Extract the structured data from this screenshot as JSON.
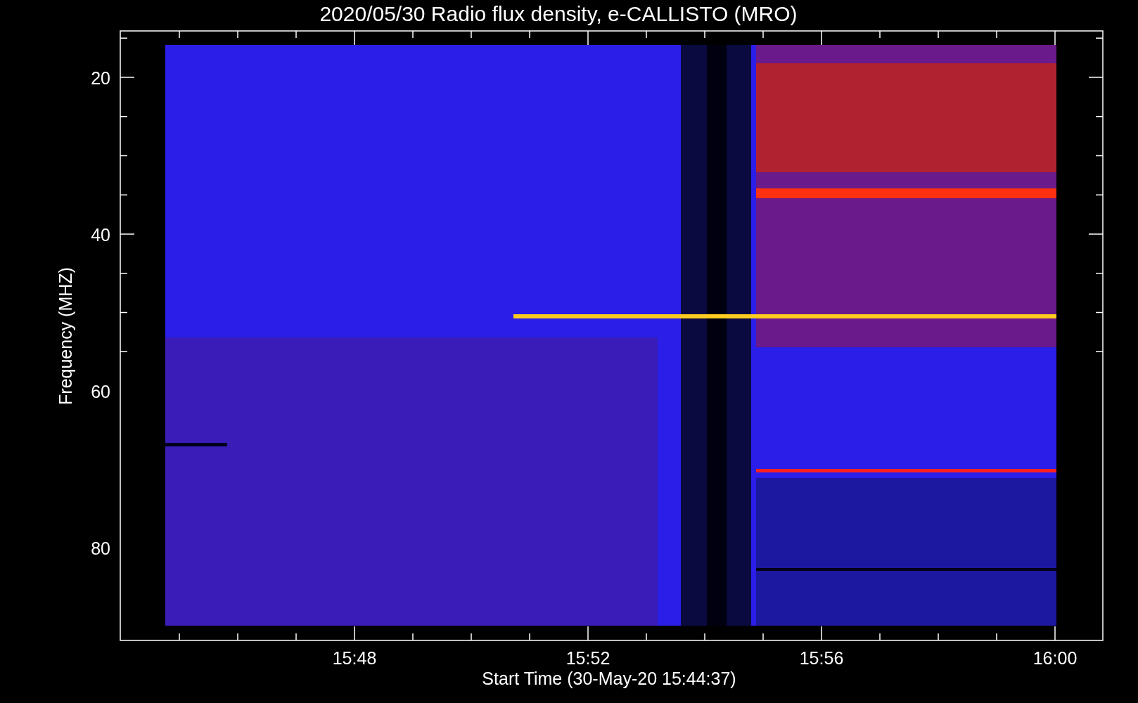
{
  "title": "2020/05/30  Radio flux density, e-CALLISTO (MRO)",
  "ylabel": "Frequency (MHZ)",
  "xlabel": "Start Time (30-May-20 15:44:37)",
  "y_tick_labels": [
    "20",
    "40",
    "60",
    "80"
  ],
  "x_tick_labels": [
    "15:48",
    "15:52",
    "15:56",
    "16:00"
  ]
}
